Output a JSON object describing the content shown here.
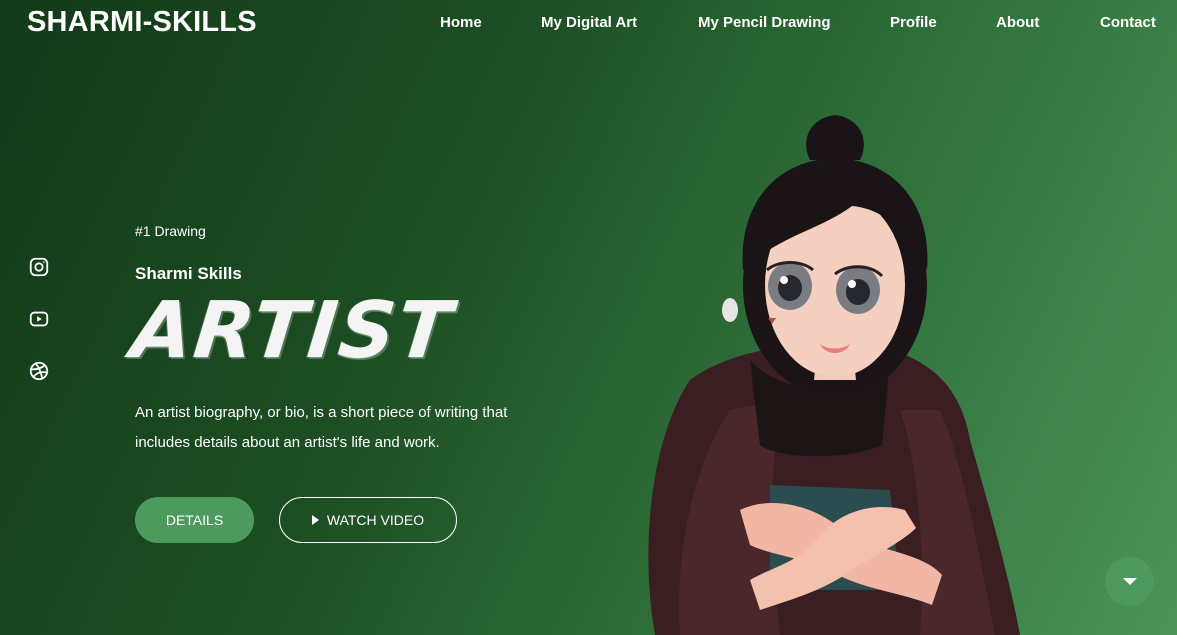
{
  "header": {
    "brand": "SHARMI-SKILLS",
    "nav": [
      "Home",
      "My Digital Art",
      "My Pencil Drawing",
      "Profile",
      "About",
      "Contact"
    ]
  },
  "social": {
    "icons": [
      "instagram-icon",
      "youtube-icon",
      "dribbble-icon"
    ]
  },
  "hero": {
    "tagline": "#1 Drawing",
    "subtitle": "Sharmi Skills",
    "headline": "ARTIST",
    "bio": "An artist biography, or bio, is a short piece of writing that includes details about an artist's life and work.",
    "details_button": "DETAILS",
    "video_button": "WATCH VIDEO"
  },
  "colors": {
    "accent": "#4e9a5e",
    "bg_dark": "#133a19",
    "bg_light": "#4a9458"
  }
}
